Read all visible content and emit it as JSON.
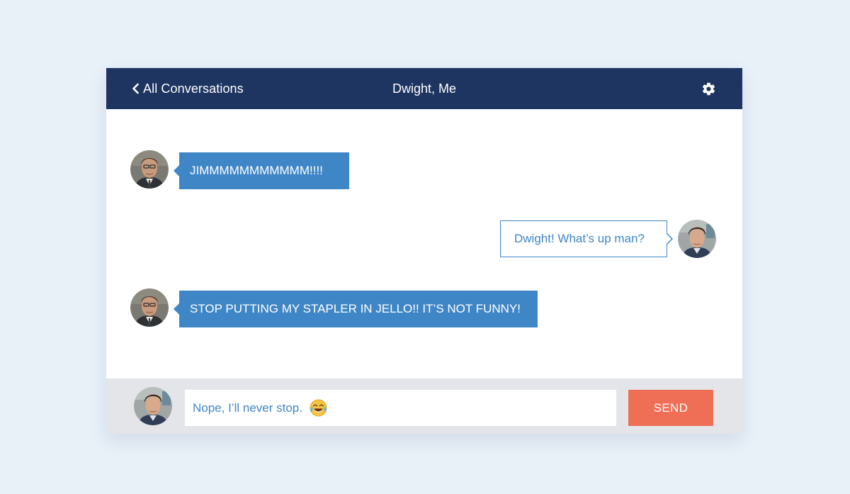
{
  "header": {
    "back_label": "All Conversations",
    "title": "Dwight, Me",
    "back_icon": "chevron-left-icon",
    "settings_icon": "gear-icon"
  },
  "messages": [
    {
      "sender": "Dwight",
      "direction": "incoming",
      "text": "JIMMMMMMMMMMM!!!!"
    },
    {
      "sender": "Me",
      "direction": "outgoing",
      "text": "Dwight! What’s up man?"
    },
    {
      "sender": "Dwight",
      "direction": "incoming",
      "text": "STOP PUTTING MY STAPLER IN JELLO!! IT’S NOT FUNNY!"
    }
  ],
  "composer": {
    "value": "Nope, I’ll never stop.",
    "emoji": "face-with-tears-of-joy-icon",
    "send_label": "SEND"
  },
  "colors": {
    "background": "#e8f0f8",
    "header": "#1e3461",
    "bubble": "#3f86c6",
    "send": "#ef6e56",
    "composer": "#e3e5e9"
  }
}
